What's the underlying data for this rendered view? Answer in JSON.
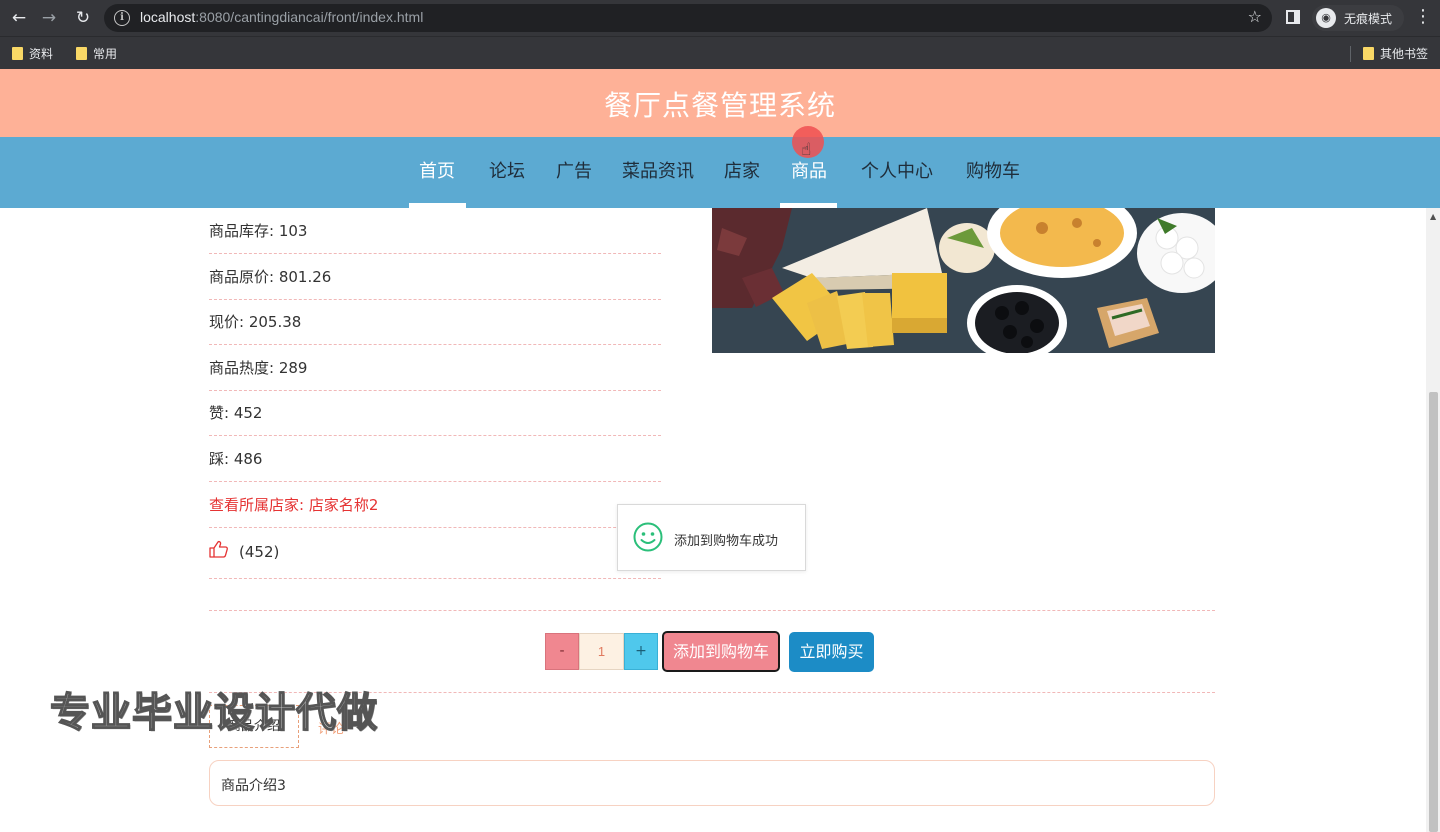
{
  "browser": {
    "url_host": "localhost",
    "url_rest": ":8080/cantingdiancai/front/index.html",
    "incognito_label": "无痕模式",
    "bookmarks": [
      "资料",
      "常用"
    ],
    "bookmarks_right": "其他书签"
  },
  "site": {
    "title": "餐厅点餐管理系统",
    "nav": [
      "首页",
      "论坛",
      "广告",
      "菜品资讯",
      "店家",
      "商品",
      "个人中心",
      "购物车"
    ]
  },
  "product": {
    "stock": "商品库存: 103",
    "original_price": "商品原价: 801.26",
    "current_price": "现价: 205.38",
    "popularity": "商品热度: 289",
    "likes": "赞: 452",
    "dislikes": "踩: 486",
    "shop_link": "查看所属店家: 店家名称2",
    "like_count": "(452)"
  },
  "toast": {
    "message": "添加到购物车成功"
  },
  "purchase": {
    "minus": "-",
    "quantity": "1",
    "plus": "+",
    "add_to_cart": "添加到购物车",
    "buy_now": "立即购买"
  },
  "tabs": {
    "intro": "商品介绍",
    "comments": "评论"
  },
  "description": "商品介绍3",
  "watermark": "专业毕业设计代做",
  "colors": {
    "header_bg": "#feb197",
    "nav_bg": "#5caad2",
    "cart_button": "#f08790",
    "buy_button": "#1c8cc6",
    "shop_link": "#e53333"
  }
}
